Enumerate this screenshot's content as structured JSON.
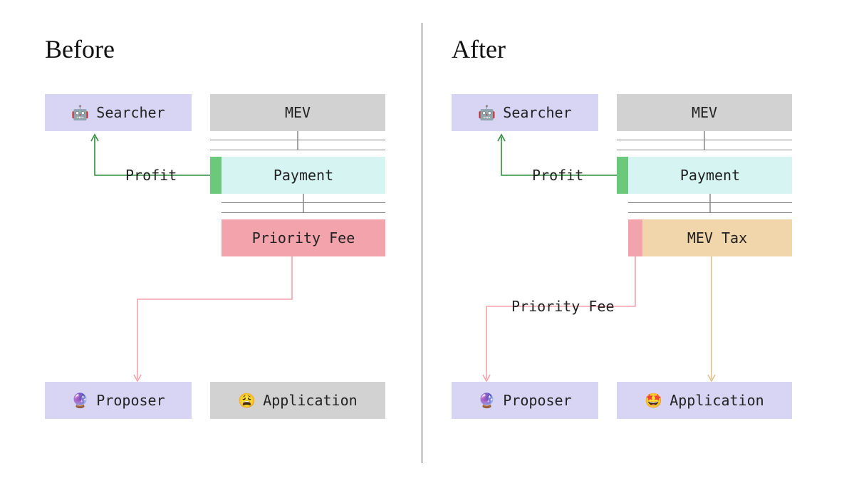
{
  "headings": {
    "before": "Before",
    "after": "After"
  },
  "labels": {
    "searcher": "Searcher",
    "mev": "MEV",
    "payment": "Payment",
    "priority_fee": "Priority Fee",
    "mev_tax": "MEV Tax",
    "proposer": "Proposer",
    "application": "Application",
    "profit": "Profit"
  },
  "icons": {
    "searcher": "🤖",
    "proposer": "🔮",
    "application_before": "😩",
    "application_after": "🤩"
  },
  "colors": {
    "purple": "#d7d4f4",
    "grey": "#d2d2d2",
    "cyan": "#d6f5f2",
    "green_accent": "#6cc97c",
    "pink": "#f2a3ab",
    "beige": "#f1d5ab",
    "profit_arrow": "#2e8b3d",
    "fee_arrow": "#f2a3ab",
    "tax_arrow": "#e0c08a"
  },
  "chart_data": {
    "type": "diagram",
    "panels": [
      {
        "name": "Before",
        "nodes": [
          {
            "id": "searcher",
            "label": "Searcher",
            "icon": "🤖",
            "color": "purple"
          },
          {
            "id": "mev",
            "label": "MEV",
            "color": "grey"
          },
          {
            "id": "payment",
            "label": "Payment",
            "color": "cyan",
            "accent_left": "green"
          },
          {
            "id": "priority_fee",
            "label": "Priority Fee",
            "color": "pink"
          },
          {
            "id": "proposer",
            "label": "Proposer",
            "icon": "🔮",
            "color": "purple"
          },
          {
            "id": "application",
            "label": "Application",
            "icon": "😩",
            "color": "grey"
          }
        ],
        "edges": [
          {
            "from": "mev",
            "to": "payment",
            "style": "bracket"
          },
          {
            "from": "payment",
            "to": "priority_fee",
            "style": "bracket"
          },
          {
            "from": "payment.green_accent",
            "to": "searcher",
            "label": "Profit",
            "color": "green",
            "arrow": true
          },
          {
            "from": "priority_fee",
            "to": "proposer",
            "color": "pink",
            "arrow": true
          }
        ]
      },
      {
        "name": "After",
        "nodes": [
          {
            "id": "searcher",
            "label": "Searcher",
            "icon": "🤖",
            "color": "purple"
          },
          {
            "id": "mev",
            "label": "MEV",
            "color": "grey"
          },
          {
            "id": "payment",
            "label": "Payment",
            "color": "cyan",
            "accent_left": "green"
          },
          {
            "id": "priority_fee_sliver",
            "label": "",
            "color": "pink"
          },
          {
            "id": "mev_tax",
            "label": "MEV Tax",
            "color": "beige"
          },
          {
            "id": "proposer",
            "label": "Proposer",
            "icon": "🔮",
            "color": "purple"
          },
          {
            "id": "application",
            "label": "Application",
            "icon": "🤩",
            "color": "purple"
          }
        ],
        "edges": [
          {
            "from": "mev",
            "to": "payment",
            "style": "bracket"
          },
          {
            "from": "payment",
            "to": "mev_tax",
            "style": "bracket"
          },
          {
            "from": "payment.green_accent",
            "to": "searcher",
            "label": "Profit",
            "color": "green",
            "arrow": true
          },
          {
            "from": "priority_fee_sliver",
            "to": "proposer",
            "label": "Priority Fee",
            "color": "pink",
            "arrow": true
          },
          {
            "from": "mev_tax",
            "to": "application",
            "color": "beige",
            "arrow": true
          }
        ]
      }
    ]
  }
}
